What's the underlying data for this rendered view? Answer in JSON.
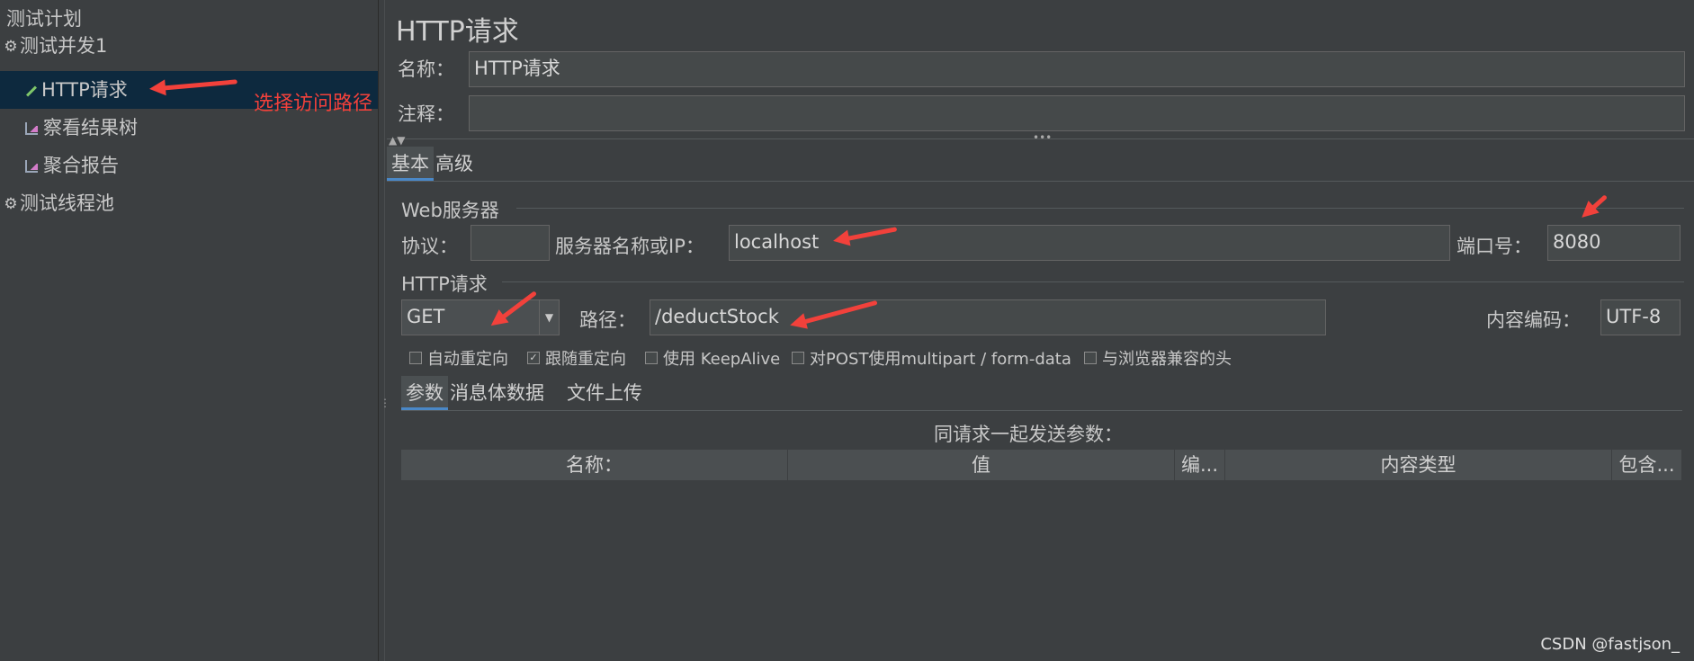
{
  "tree": {
    "items": [
      {
        "label": "测试计划",
        "icon": "none",
        "selected": false
      },
      {
        "label": "测试并发1",
        "icon": "gear-icon",
        "selected": false
      },
      {
        "label": "HTTP请求",
        "icon": "pencil-icon",
        "selected": true
      },
      {
        "label": "察看结果树",
        "icon": "chart-icon",
        "selected": false
      },
      {
        "label": "聚合报告",
        "icon": "chart-icon",
        "selected": false
      },
      {
        "label": "测试线程池",
        "icon": "gear-icon",
        "selected": false
      }
    ],
    "annotation": "选择访问路径"
  },
  "panel": {
    "title": "HTTP请求",
    "name_label": "名称：",
    "name_value": "HTTP请求",
    "comment_label": "注释：",
    "comment_value": "",
    "tabs": [
      "基本",
      "高级"
    ],
    "active_tab": "基本"
  },
  "web_server": {
    "section_title": "Web服务器",
    "protocol_label": "协议：",
    "protocol_value": "",
    "server_label": "服务器名称或IP：",
    "server_value": "localhost",
    "port_label": "端口号：",
    "port_value": "8080"
  },
  "http_request": {
    "section_title": "HTTP请求",
    "method_value": "GET",
    "path_label": "路径：",
    "path_value": "/deductStock",
    "encoding_label": "内容编码：",
    "encoding_value": "UTF-8"
  },
  "options": [
    {
      "label": "自动重定向",
      "checked": false
    },
    {
      "label": "跟随重定向",
      "checked": true
    },
    {
      "label": "使用 KeepAlive",
      "checked": false
    },
    {
      "label": "对POST使用multipart / form-data",
      "checked": false
    },
    {
      "label": "与浏览器兼容的头",
      "checked": false
    }
  ],
  "param_tabs": [
    "参数",
    "消息体数据",
    "文件上传"
  ],
  "params": {
    "caption": "同请求一起发送参数：",
    "columns": [
      "名称：",
      "值",
      "编...",
      "内容类型",
      "包含..."
    ]
  },
  "watermark": "CSDN @fastjson_",
  "colors": {
    "background": "#3c3f41",
    "selected_row": "#0d293e",
    "annotation_red": "#f2413b",
    "accent": "#4a88c7"
  }
}
